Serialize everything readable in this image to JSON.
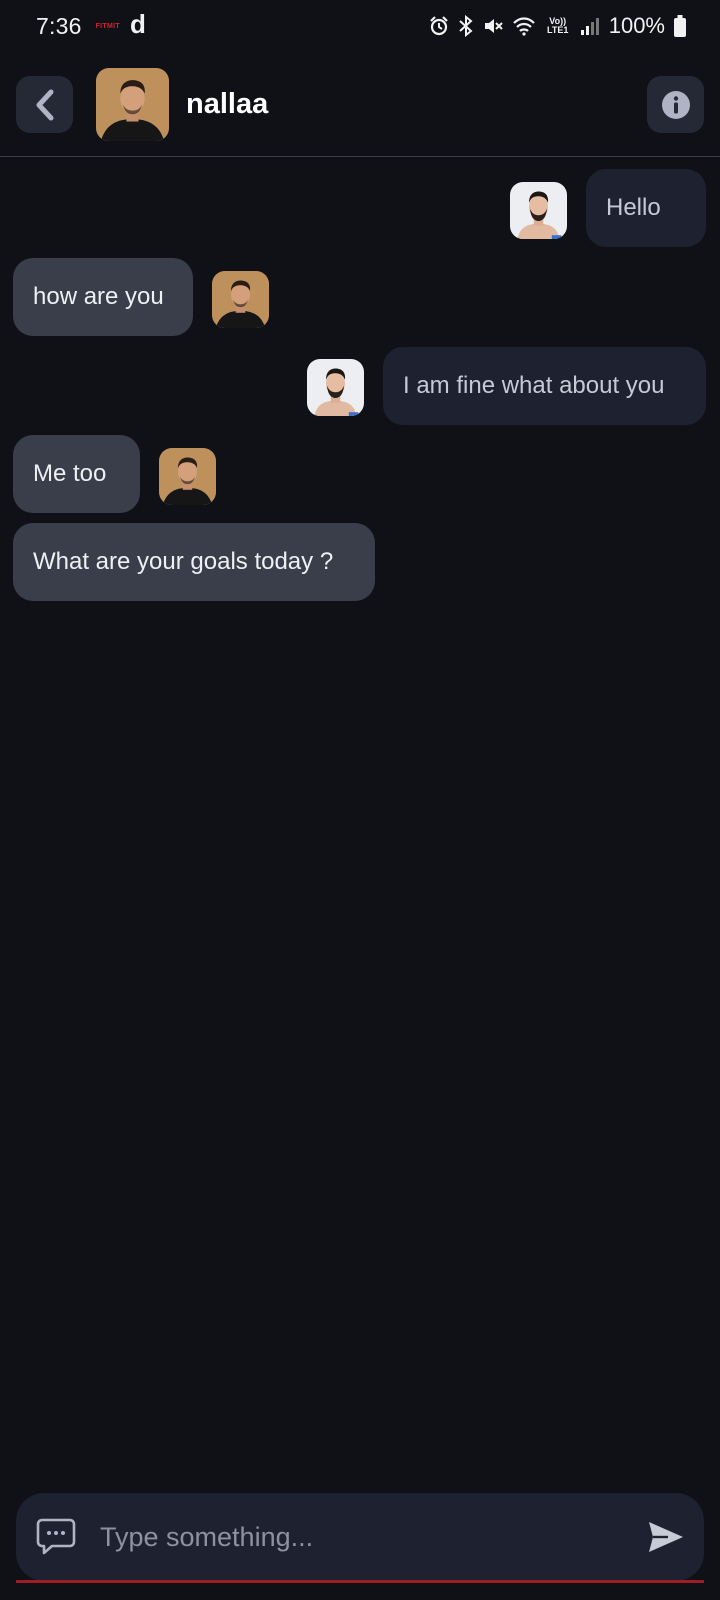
{
  "status_bar": {
    "time": "7:36",
    "app_badge": "FITMIT",
    "app_letter": "d",
    "network": "Vo)) LTE1",
    "battery": "100%"
  },
  "header": {
    "contact_name": "nallaa",
    "back_icon": "chevron-left-icon",
    "info_icon": "info-icon"
  },
  "messages": [
    {
      "direction": "sent",
      "text": "Hello"
    },
    {
      "direction": "received",
      "text": "how are you"
    },
    {
      "direction": "sent",
      "text": "I am fine what about you"
    },
    {
      "direction": "received",
      "text": "Me too"
    },
    {
      "direction": "received",
      "text": "What are your goals today ?"
    }
  ],
  "composer": {
    "placeholder": "Type something...",
    "value": "",
    "chat_icon": "chat-bubble-icon",
    "send_icon": "send-icon"
  },
  "colors": {
    "background": "#0f1117",
    "sent_bubble": "#1e2130",
    "received_bubble": "#3a3e4a",
    "accent_underline": "#a11d25"
  }
}
